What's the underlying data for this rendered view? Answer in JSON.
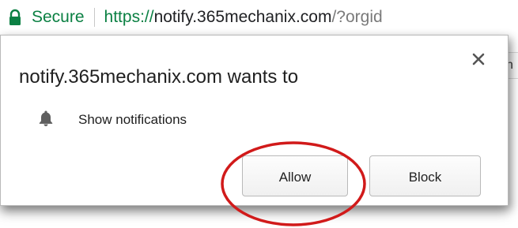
{
  "address_bar": {
    "secure_label": "Secure",
    "url_scheme": "https://",
    "url_host": "notify.365mechanix.com",
    "url_path": "/?orgid"
  },
  "background": {
    "edge_text": "n"
  },
  "popup": {
    "title": "notify.365mechanix.com wants to",
    "permission_label": "Show notifications",
    "allow_label": "Allow",
    "block_label": "Block",
    "icons": {
      "lock": "lock-icon",
      "bell": "bell-icon",
      "close": "close-icon"
    }
  },
  "colors": {
    "secure_green": "#0b8043",
    "annotation_red": "#d11a1a"
  }
}
